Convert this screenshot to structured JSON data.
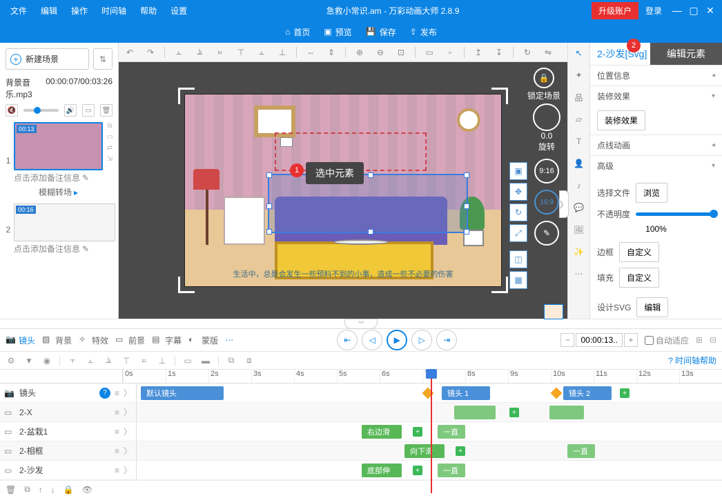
{
  "titlebar": {
    "menus": [
      "文件",
      "编辑",
      "操作",
      "时间轴",
      "帮助",
      "设置"
    ],
    "title": "急救小常识.am - 万彩动画大师 2.8.9",
    "upgrade": "升级账户",
    "login": "登录"
  },
  "main_toolbar": {
    "home": "首页",
    "preview": "预览",
    "save": "保存",
    "publish": "发布"
  },
  "left": {
    "new_scene": "新建场景",
    "bgm_file": "背景音乐.mp3",
    "bgm_time": "00:00:07/00:03:26",
    "scene1_time": "00:13",
    "scene2_time": "00:16",
    "note_placeholder": "点击添加备注信息",
    "transition": "模糊转场"
  },
  "canvas": {
    "lock_scene": "锁定场景",
    "rotate": "旋转",
    "rotate_val": "0.0",
    "time": "9:16",
    "ratio": "16:9",
    "select_tip": "选中元素",
    "badge1": "1",
    "foot_text": "生活中，总是会发生一些预料不到的小事，造成一些不必要的伤害"
  },
  "right": {
    "edit_elem": "编辑元素",
    "badge2": "2",
    "elem_name": "2-沙发[Svg]",
    "pos_info": "位置信息",
    "deco_header": "装修效果",
    "deco_btn": "装修效果",
    "anim_header": "点线动画",
    "advanced": "高级",
    "select_file": "选择文件",
    "browse": "浏览",
    "opacity": "不透明度",
    "opacity_val": "100%",
    "border": "边框",
    "fill": "填充",
    "custom": "自定义",
    "design_svg": "设计SVG",
    "edit": "编辑"
  },
  "mid": {
    "camera": "镜头",
    "bg": "背景",
    "fx": "特效",
    "fg": "前景",
    "subtitle": "字幕",
    "mask": "蒙版",
    "time_val": "00:00:13..",
    "auto_fit": "自动适应",
    "help": "时间轴帮助"
  },
  "timeline": {
    "ticks": [
      "0s",
      "1s",
      "2s",
      "3s",
      "4s",
      "5s",
      "6s",
      "7s",
      "8s",
      "9s",
      "10s",
      "11s",
      "12s",
      "13s"
    ],
    "rows": [
      {
        "name": "镜头"
      },
      {
        "name": "2-X"
      },
      {
        "name": "2-盆栽1"
      },
      {
        "name": "2-相框"
      },
      {
        "name": "2-沙发"
      }
    ],
    "default_cam": "默认镜头",
    "cam1": "镜头 1",
    "cam2": "镜头 2",
    "right_slide": "右边滑",
    "down_slide": "向下滑",
    "bottom_stretch": "底部伸",
    "always": "一直"
  }
}
